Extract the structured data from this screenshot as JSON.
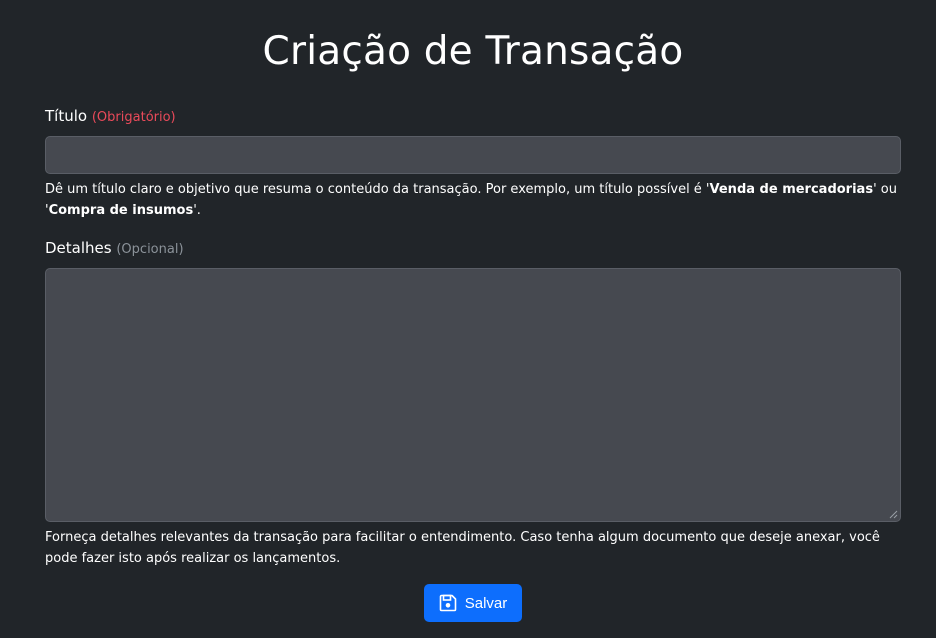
{
  "page": {
    "title": "Criação de Transação"
  },
  "title_field": {
    "label": "Título",
    "badge": "(Obrigatório)",
    "value": "",
    "help_part1": "Dê um título claro e objetivo que resuma o conteúdo da transação. Por exemplo, um título possível é '",
    "example1": "Venda de mercadorias",
    "help_part2": "' ou '",
    "example2": "Compra de insumos",
    "help_part3": "'."
  },
  "details_field": {
    "label": "Detalhes",
    "badge": "(Opcional)",
    "value": "",
    "help": "Forneça detalhes relevantes da transação para facilitar o entendimento. Caso tenha algum documento que deseje anexar, você pode fazer isto após realizar os lançamentos."
  },
  "actions": {
    "save_label": "Salvar",
    "save_icon": "floppy-disk-icon"
  },
  "colors": {
    "background": "#212529",
    "input_bg": "#464950",
    "primary": "#0d6efd",
    "required": "#ea4a5a",
    "optional": "#8b9299"
  }
}
